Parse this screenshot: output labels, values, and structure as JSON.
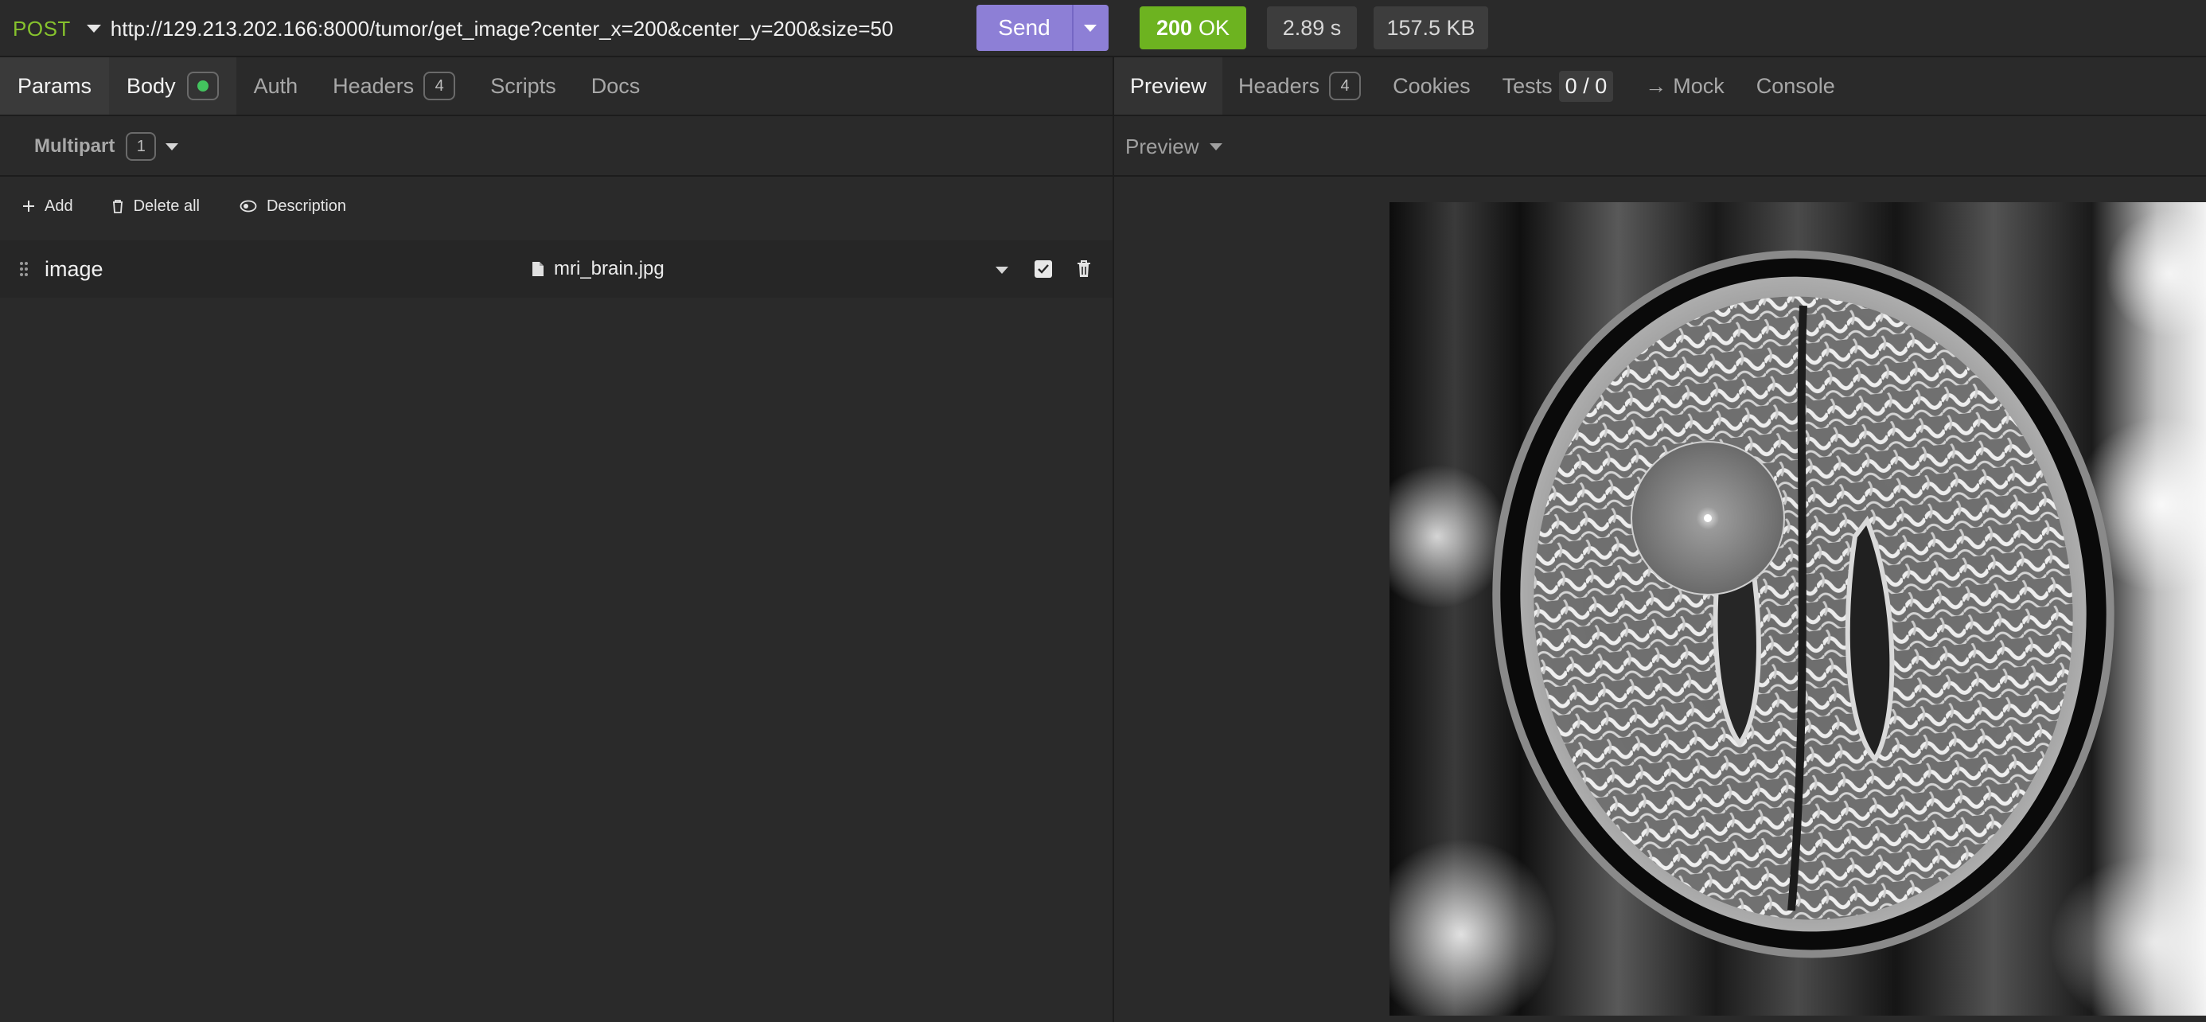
{
  "request": {
    "method": "POST",
    "url": "http://129.213.202.166:8000/tumor/get_image?center_x=200&center_y=200&size=50",
    "send_label": "Send"
  },
  "response_status": {
    "code": "200",
    "text": "OK",
    "time": "2.89 s",
    "size": "157.5 KB"
  },
  "request_tabs": {
    "params": "Params",
    "body": "Body",
    "auth": "Auth",
    "headers": "Headers",
    "headers_count": "4",
    "scripts": "Scripts",
    "docs": "Docs"
  },
  "body_type": {
    "label": "Multipart",
    "count": "1"
  },
  "body_actions": {
    "add": "Add",
    "delete_all": "Delete all",
    "description": "Description"
  },
  "multipart_fields": [
    {
      "name": "image",
      "file": "mri_brain.jpg",
      "enabled": true
    }
  ],
  "response_tabs": {
    "preview": "Preview",
    "headers": "Headers",
    "headers_count": "4",
    "cookies": "Cookies",
    "tests": "Tests",
    "tests_count": "0 / 0",
    "mock": "Mock",
    "console": "Console"
  },
  "preview_mode": "Preview",
  "colors": {
    "method": "#86c22d",
    "send_button": "#8d7fd6",
    "status_ok": "#6db320",
    "body_dot": "#43c35e",
    "background": "#2a2a2a"
  },
  "icons": {
    "add": "plus-icon",
    "delete_all": "trash-icon",
    "description": "eye-toggle-icon",
    "drag": "drag-handle-icon",
    "file": "file-icon",
    "row_enabled": "checkbox-icon",
    "row_delete": "trash-icon",
    "mock": "arrow-right-icon"
  }
}
